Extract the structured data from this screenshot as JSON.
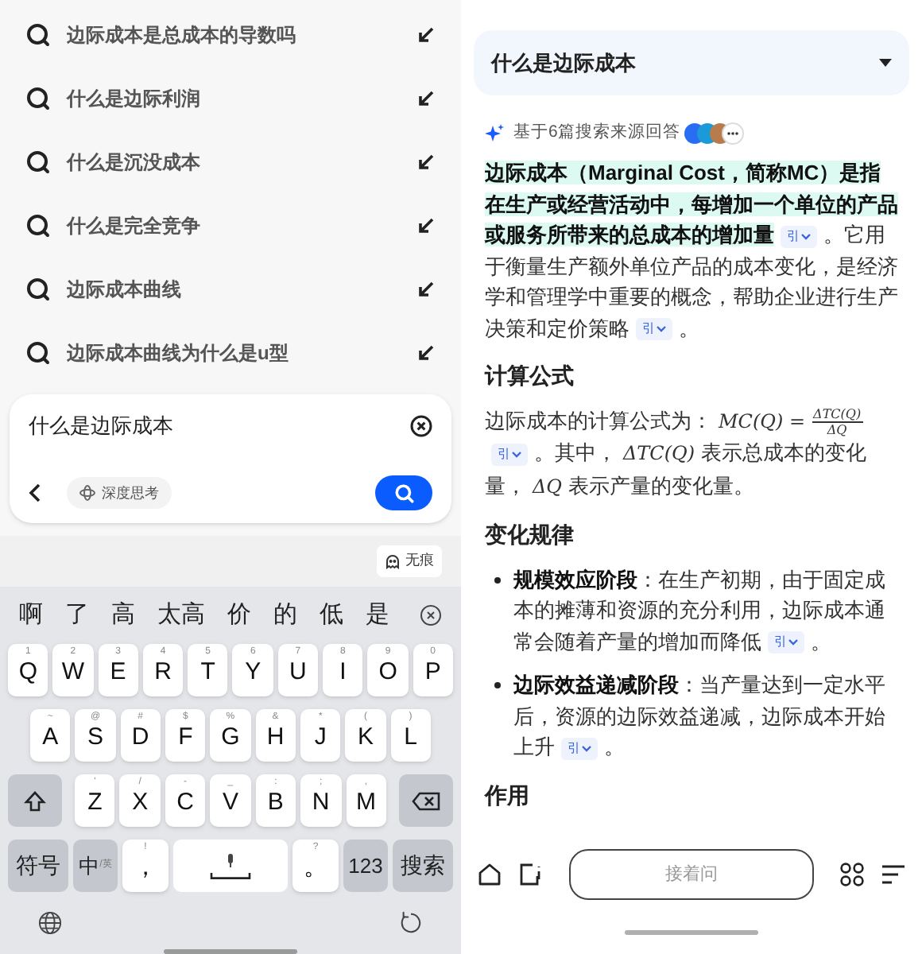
{
  "left": {
    "suggestions": [
      {
        "text": "边际成本是总成本的导数吗"
      },
      {
        "text": "什么是边际利润"
      },
      {
        "text": "什么是沉没成本"
      },
      {
        "text": "什么是完全竞争"
      },
      {
        "text": "边际成本曲线"
      },
      {
        "text": "边际成本曲线为什么是u型"
      }
    ],
    "query": {
      "value": "什么是边际成本"
    },
    "deep_think": {
      "label": "深度思考",
      "selected": false
    },
    "incognito": {
      "label": "无痕"
    },
    "candidates": [
      "啊",
      "了",
      "高",
      "太高",
      "价",
      "的",
      "低",
      "是"
    ],
    "keyboard": [
      [
        {
          "kind": "letter",
          "label": "Q",
          "hint": "1"
        },
        {
          "kind": "letter",
          "label": "W",
          "hint": "2"
        },
        {
          "kind": "letter",
          "label": "E",
          "hint": "3"
        },
        {
          "kind": "letter",
          "label": "R",
          "hint": "4"
        },
        {
          "kind": "letter",
          "label": "T",
          "hint": "5"
        },
        {
          "kind": "letter",
          "label": "Y",
          "hint": "6"
        },
        {
          "kind": "letter",
          "label": "U",
          "hint": "7"
        },
        {
          "kind": "letter",
          "label": "I",
          "hint": "8"
        },
        {
          "kind": "letter",
          "label": "O",
          "hint": "9"
        },
        {
          "kind": "letter",
          "label": "P",
          "hint": "0"
        }
      ],
      [
        {
          "kind": "letter",
          "label": "A",
          "hint": "~"
        },
        {
          "kind": "letter",
          "label": "S",
          "hint": "@"
        },
        {
          "kind": "letter",
          "label": "D",
          "hint": "#"
        },
        {
          "kind": "letter",
          "label": "F",
          "hint": "$"
        },
        {
          "kind": "letter",
          "label": "G",
          "hint": "%"
        },
        {
          "kind": "letter",
          "label": "H",
          "hint": "&"
        },
        {
          "kind": "letter",
          "label": "J",
          "hint": "*"
        },
        {
          "kind": "letter",
          "label": "K",
          "hint": "("
        },
        {
          "kind": "letter",
          "label": "L",
          "hint": ")"
        }
      ],
      [
        {
          "kind": "shift"
        },
        {
          "kind": "letter",
          "label": "Z",
          "hint": "'"
        },
        {
          "kind": "letter",
          "label": "X",
          "hint": "/"
        },
        {
          "kind": "letter",
          "label": "C",
          "hint": "-"
        },
        {
          "kind": "letter",
          "label": "V",
          "hint": "_"
        },
        {
          "kind": "letter",
          "label": "B",
          "hint": ":"
        },
        {
          "kind": "letter",
          "label": "N",
          "hint": ";"
        },
        {
          "kind": "letter",
          "label": "M",
          "hint": ","
        },
        {
          "kind": "backspace"
        }
      ],
      [
        {
          "kind": "function",
          "label": "符号"
        },
        {
          "kind": "language",
          "label": "中",
          "sub": "/英"
        },
        {
          "kind": "letter",
          "label": "，",
          "hint": "!"
        },
        {
          "kind": "space"
        },
        {
          "kind": "letter",
          "label": "。",
          "hint": "?"
        },
        {
          "kind": "function",
          "label": "123"
        },
        {
          "kind": "function",
          "label": "搜索"
        }
      ]
    ]
  },
  "right": {
    "question": {
      "text": "什么是边际成本"
    },
    "sources": {
      "label": "基于6篇搜索来源回答"
    },
    "blocks": [
      {
        "kind": "paragraph",
        "segments": [
          {
            "kind": "highlight",
            "text": "边际成本（Marginal Cost，简称MC）是指在生产或经营活动中，每增加一个单位的产品或服务所带来的总成本的增加量"
          },
          {
            "kind": "cite",
            "text": "引"
          },
          {
            "kind": "text",
            "text": "。它用于衡量生产额外单位产品的成本变化，是经济学和管理学中重要的概念，帮助企业进行生产决策和定价策略"
          },
          {
            "kind": "cite",
            "text": "引"
          },
          {
            "kind": "text",
            "text": "。"
          }
        ]
      },
      {
        "kind": "heading",
        "text": "计算公式"
      },
      {
        "kind": "paragraph",
        "segments": [
          {
            "kind": "text",
            "text": "边际成本的计算公式为："
          },
          {
            "kind": "math",
            "text": "MC(Q) ="
          },
          {
            "kind": "fraction",
            "numerator": "ΔTC(Q)",
            "denominator": "ΔQ"
          },
          {
            "kind": "cite",
            "text": "引"
          },
          {
            "kind": "text",
            "text": "。其中，"
          },
          {
            "kind": "math",
            "text": "ΔTC(Q)"
          },
          {
            "kind": "text",
            "text": "表示总成本的变化量，"
          },
          {
            "kind": "math",
            "text": "ΔQ"
          },
          {
            "kind": "text",
            "text": "表示产量的变化量。"
          }
        ]
      },
      {
        "kind": "heading",
        "text": "变化规律"
      },
      {
        "kind": "bullet",
        "segments": [
          {
            "kind": "bold",
            "text": "规模效应阶段"
          },
          {
            "kind": "text",
            "text": "：在生产初期，由于固定成本的摊薄和资源的充分利用，边际成本通常会随着产量的增加而降低"
          },
          {
            "kind": "cite",
            "text": "引"
          },
          {
            "kind": "text",
            "text": "。"
          }
        ]
      },
      {
        "kind": "bullet",
        "segments": [
          {
            "kind": "bold",
            "text": "边际效益递减阶段"
          },
          {
            "kind": "text",
            "text": "：当产量达到一定水平后，资源的边际效益递减，边际成本开始上升"
          },
          {
            "kind": "cite",
            "text": "引"
          },
          {
            "kind": "text",
            "text": "。"
          }
        ]
      },
      {
        "kind": "heading",
        "text": "作用"
      }
    ],
    "follow_up": {
      "placeholder": "接着问"
    }
  }
}
